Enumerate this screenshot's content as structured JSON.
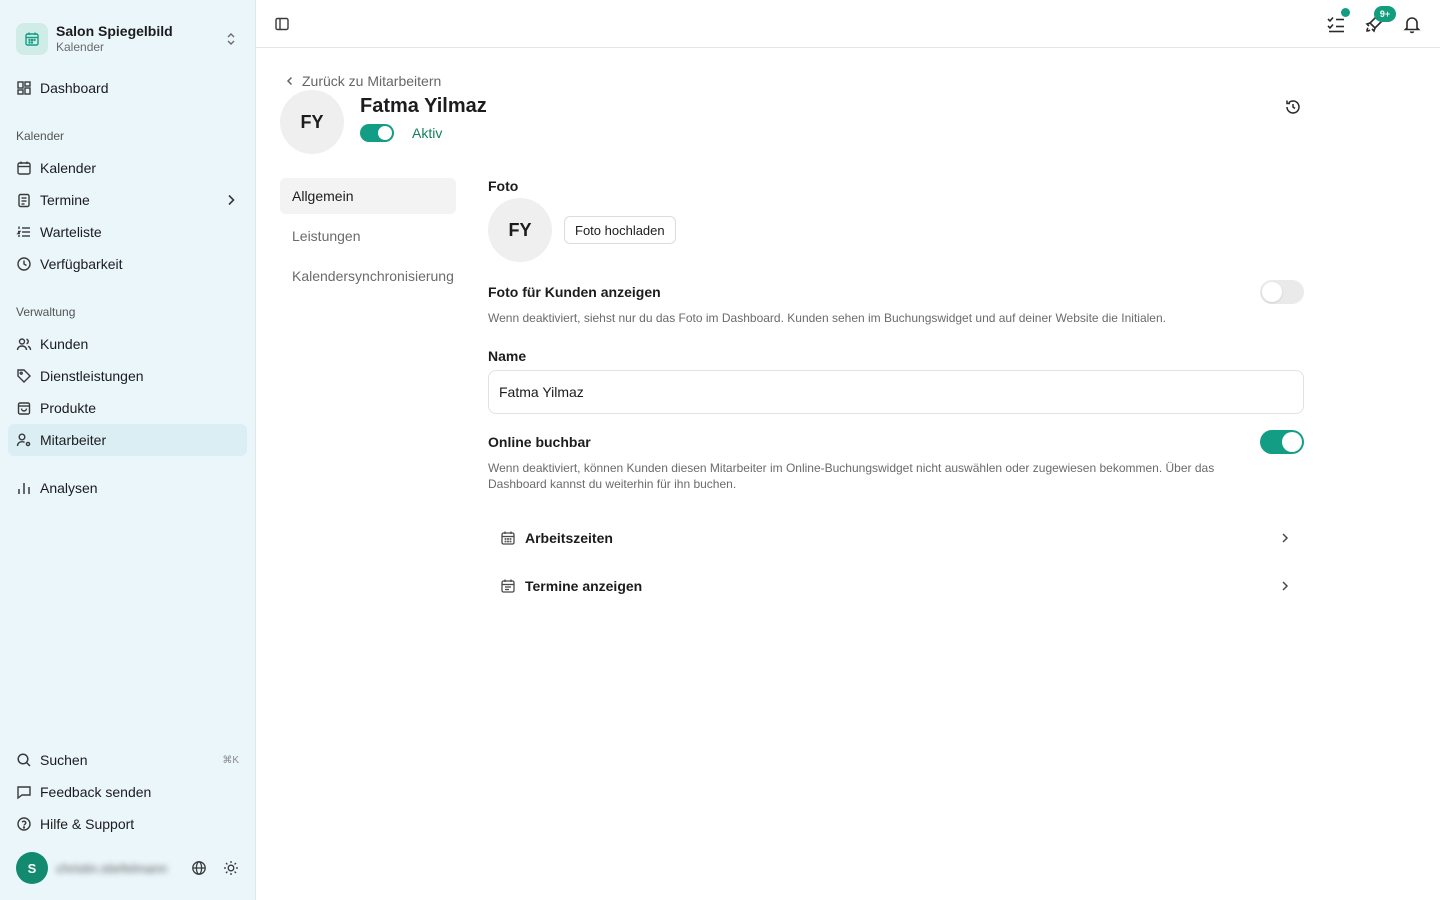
{
  "org": {
    "name": "Salon Spiegelbild",
    "section": "Kalender"
  },
  "nav": {
    "dashboard": "Dashboard",
    "section_calendar": "Kalender",
    "calendar": "Kalender",
    "appointments": "Termine",
    "waitlist": "Warteliste",
    "availability": "Verfügbarkeit",
    "section_management": "Verwaltung",
    "customers": "Kunden",
    "services": "Dienstleistungen",
    "products": "Produkte",
    "employees": "Mitarbeiter",
    "analytics": "Analysen",
    "search": "Suchen",
    "search_shortcut": "⌘K",
    "feedback": "Feedback senden",
    "help": "Hilfe & Support"
  },
  "user": {
    "initial": "S",
    "name": "christin.stiefelmann"
  },
  "topbar": {
    "notifications_badge": "9+"
  },
  "back_link": "Zurück zu Mitarbeitern",
  "employee": {
    "initials": "FY",
    "name": "Fatma Yilmaz",
    "active": true,
    "status_label": "Aktiv"
  },
  "tabs": [
    "Allgemein",
    "Leistungen",
    "Kalendersynchronisierung"
  ],
  "form": {
    "photo_label": "Foto",
    "photo_initials": "FY",
    "upload_button": "Foto hochladen",
    "show_photo_label": "Foto für Kunden anzeigen",
    "show_photo_enabled": false,
    "show_photo_help": "Wenn deaktiviert, siehst nur du das Foto im Dashboard. Kunden sehen im Buchungswidget und auf deiner Website die Initialen.",
    "name_label": "Name",
    "name_value": "Fatma Yilmaz",
    "online_label": "Online buchbar",
    "online_enabled": true,
    "online_help": "Wenn deaktiviert, können Kunden diesen Mitarbeiter im Online-Buchungswidget nicht auswählen oder zugewiesen bekommen. Über das Dashboard kannst du weiterhin für ihn buchen.",
    "link_working_hours": "Arbeitszeiten",
    "link_appointments": "Termine anzeigen"
  },
  "colors": {
    "accent": "#139d85",
    "sidebar_bg": "#eaf6fa",
    "active_nav": "#dbeef4"
  }
}
